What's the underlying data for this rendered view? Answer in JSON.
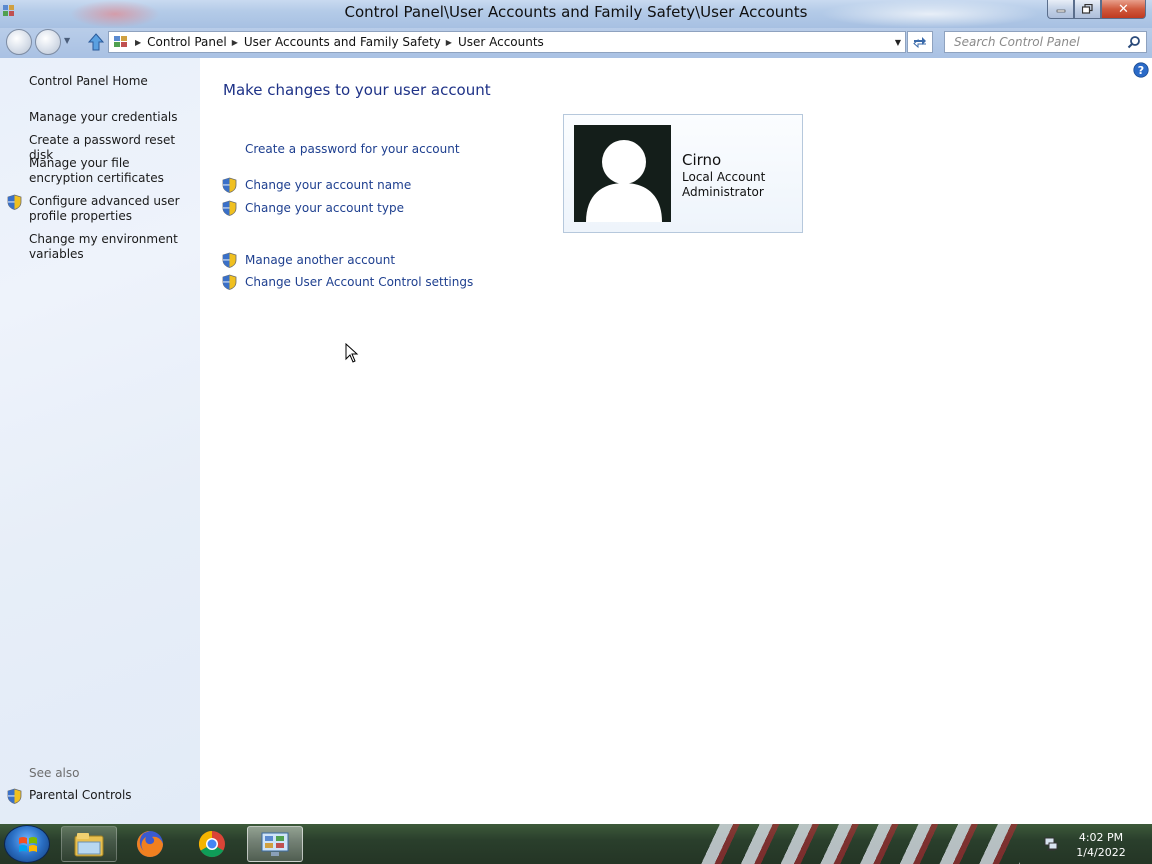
{
  "window": {
    "title": "Control Panel\\User Accounts and Family Safety\\User Accounts",
    "close_glyph": "✕"
  },
  "nav": {
    "breadcrumbs": [
      "Control Panel",
      "User Accounts and Family Safety",
      "User Accounts"
    ],
    "search_placeholder": "Search Control Panel"
  },
  "sidebar": {
    "home": "Control Panel Home",
    "items": [
      "Manage your credentials",
      "Create a password reset disk",
      "Manage your file encryption certificates",
      "Configure advanced user profile properties",
      "Change my environment variables"
    ],
    "see_also_label": "See also",
    "see_also_items": [
      "Parental Controls"
    ]
  },
  "main": {
    "title": "Make changes to your user account",
    "tasks": [
      "Create a password for your account",
      "Change your account name",
      "Change your account type",
      "Manage another account",
      "Change User Account Control settings"
    ]
  },
  "account": {
    "name": "Cirno",
    "type": "Local Account",
    "role": "Administrator"
  },
  "taskbar": {
    "time": "4:02 PM",
    "date": "1/4/2022"
  },
  "icons": {
    "shield": "uac-shield-icon",
    "help": "help-icon",
    "search": "search-icon",
    "up": "up-arrow-icon"
  },
  "colors": {
    "link": "#1e3f8f",
    "title": "#1e3287",
    "sidebar_bg": "#e9f0fa"
  }
}
